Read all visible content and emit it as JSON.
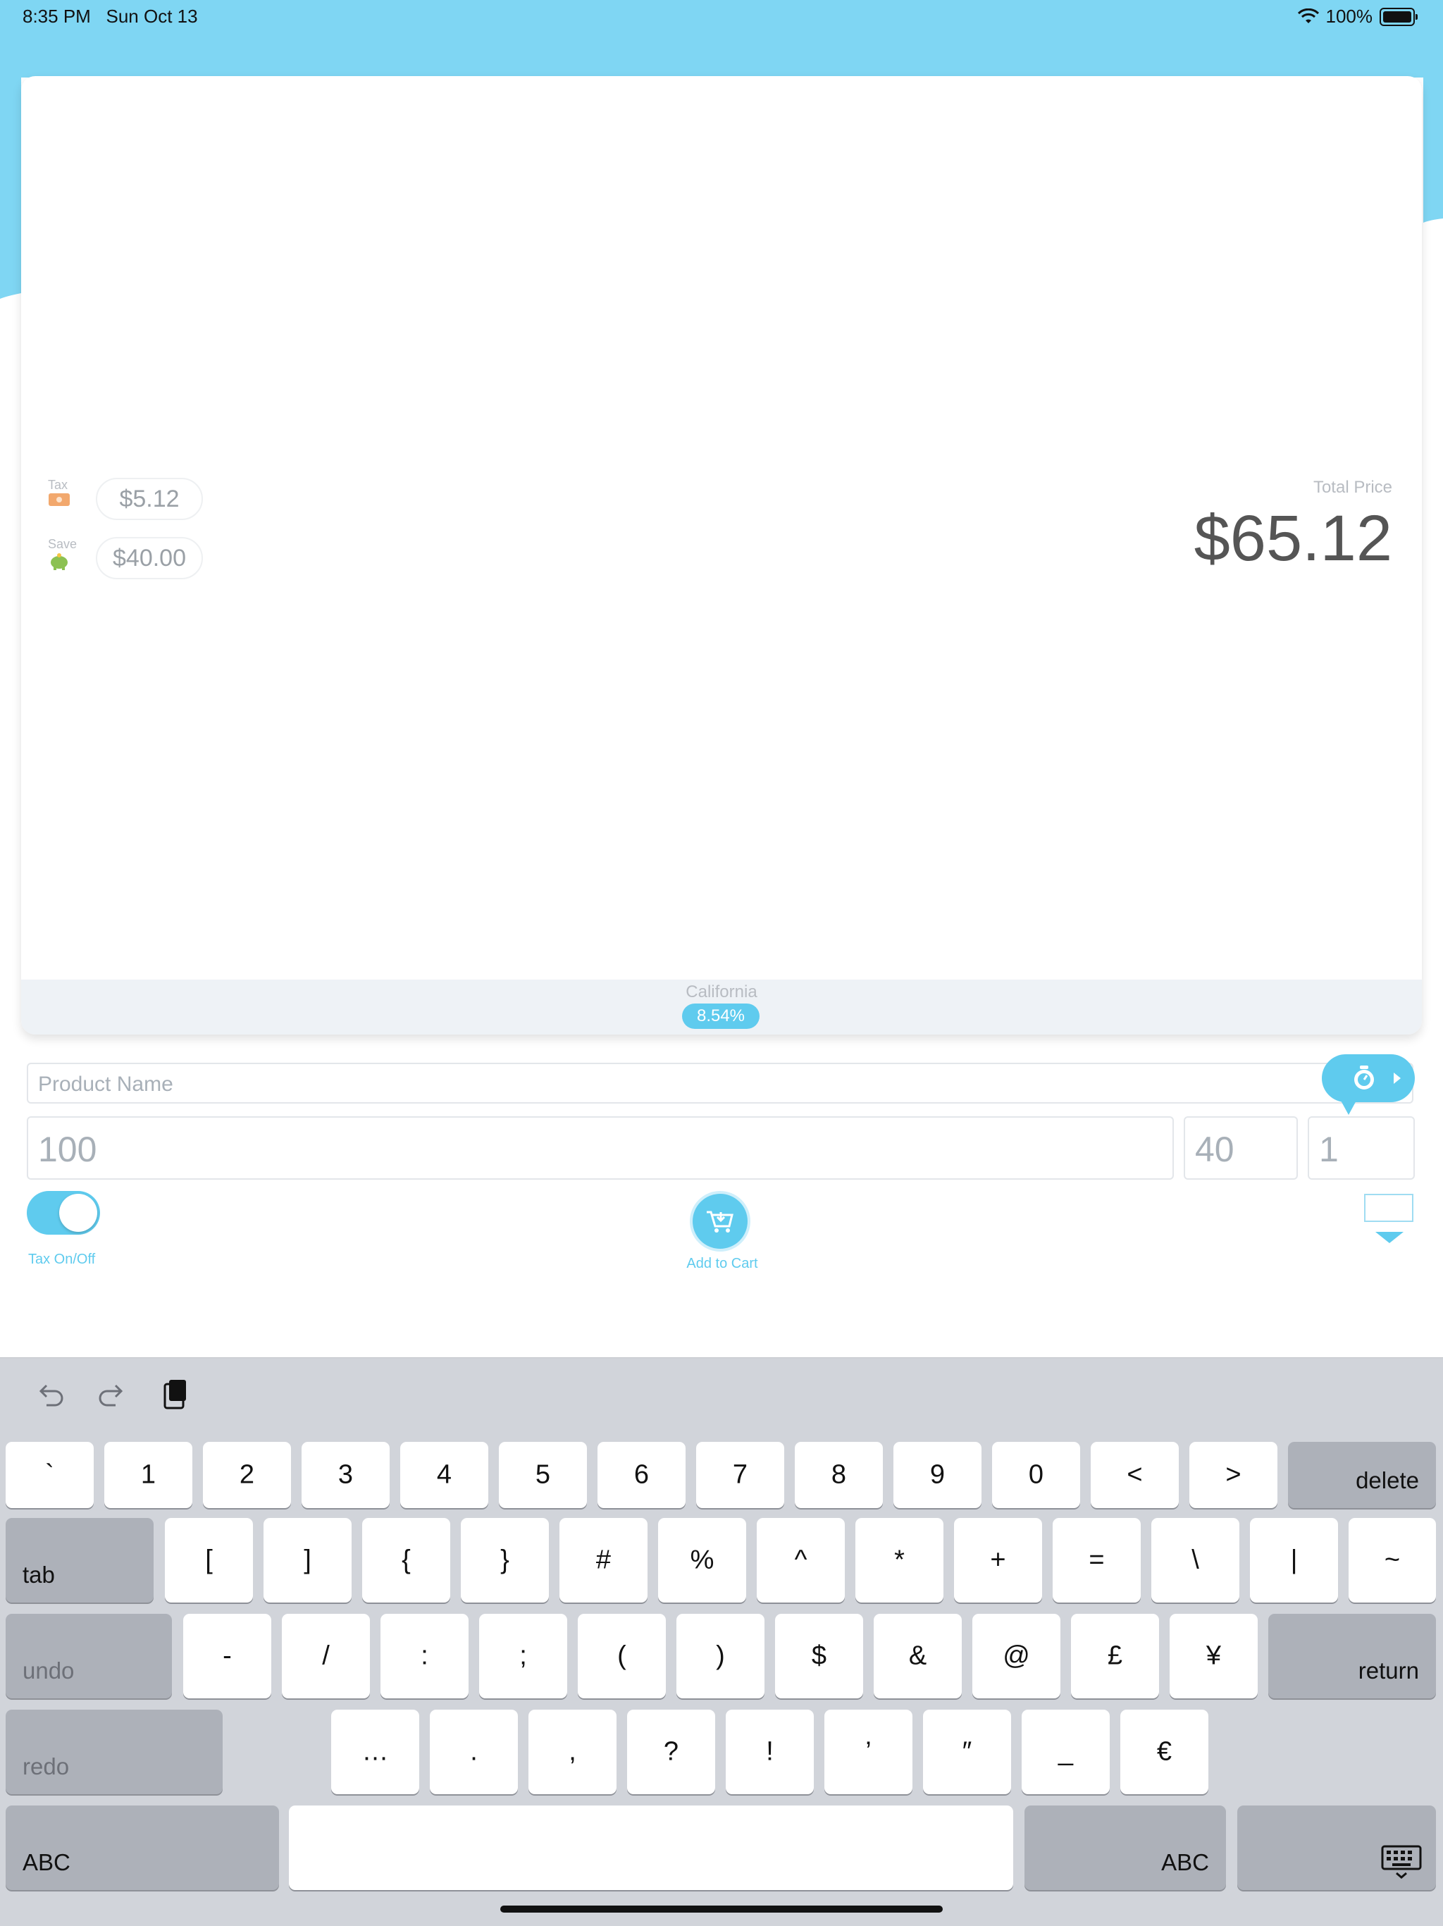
{
  "status_bar": {
    "time": "8:35 PM",
    "date": "Sun Oct 13",
    "battery": "100%"
  },
  "colors": {
    "accent": "#5fcbee",
    "header": "#7fd6f3",
    "keyboard_bg": "#d1d4da"
  },
  "summary": {
    "tax": {
      "label": "Tax",
      "value": "$5.12",
      "icon": "money-icon"
    },
    "save": {
      "label": "Save",
      "value": "$40.00",
      "icon": "piggy-bank-icon"
    },
    "total": {
      "label": "Total Price",
      "value": "$65.12"
    }
  },
  "location": {
    "state": "California",
    "rate": "8.54%"
  },
  "form": {
    "product_name_placeholder": "Product Name",
    "price": "100",
    "discount": "40",
    "quantity": "1"
  },
  "controls": {
    "tax_toggle_label": "Tax On/Off",
    "tax_on": true,
    "add_to_cart_label": "Add to Cart"
  },
  "keyboard": {
    "toolbar": [
      "undo-icon",
      "redo-icon",
      "paste-icon"
    ],
    "row1": [
      "`",
      "1",
      "2",
      "3",
      "4",
      "5",
      "6",
      "7",
      "8",
      "9",
      "0",
      "<",
      ">"
    ],
    "row1_delete": "delete",
    "row2_tab": "tab",
    "row2": [
      "[",
      "]",
      "{",
      "}",
      "#",
      "%",
      "^",
      "*",
      "+",
      "=",
      "\\",
      "|",
      "~"
    ],
    "row3_undo": "undo",
    "row3": [
      "-",
      "/",
      ":",
      ";",
      "(",
      ")",
      "$",
      "&",
      "@",
      "£",
      "¥"
    ],
    "row3_return": "return",
    "row4_redo": "redo",
    "row4": [
      "…",
      ".",
      ",",
      "?",
      "!",
      "’",
      "″",
      "_",
      "€"
    ],
    "row5_abc_left": "ABC",
    "row5_abc_right": "ABC"
  }
}
